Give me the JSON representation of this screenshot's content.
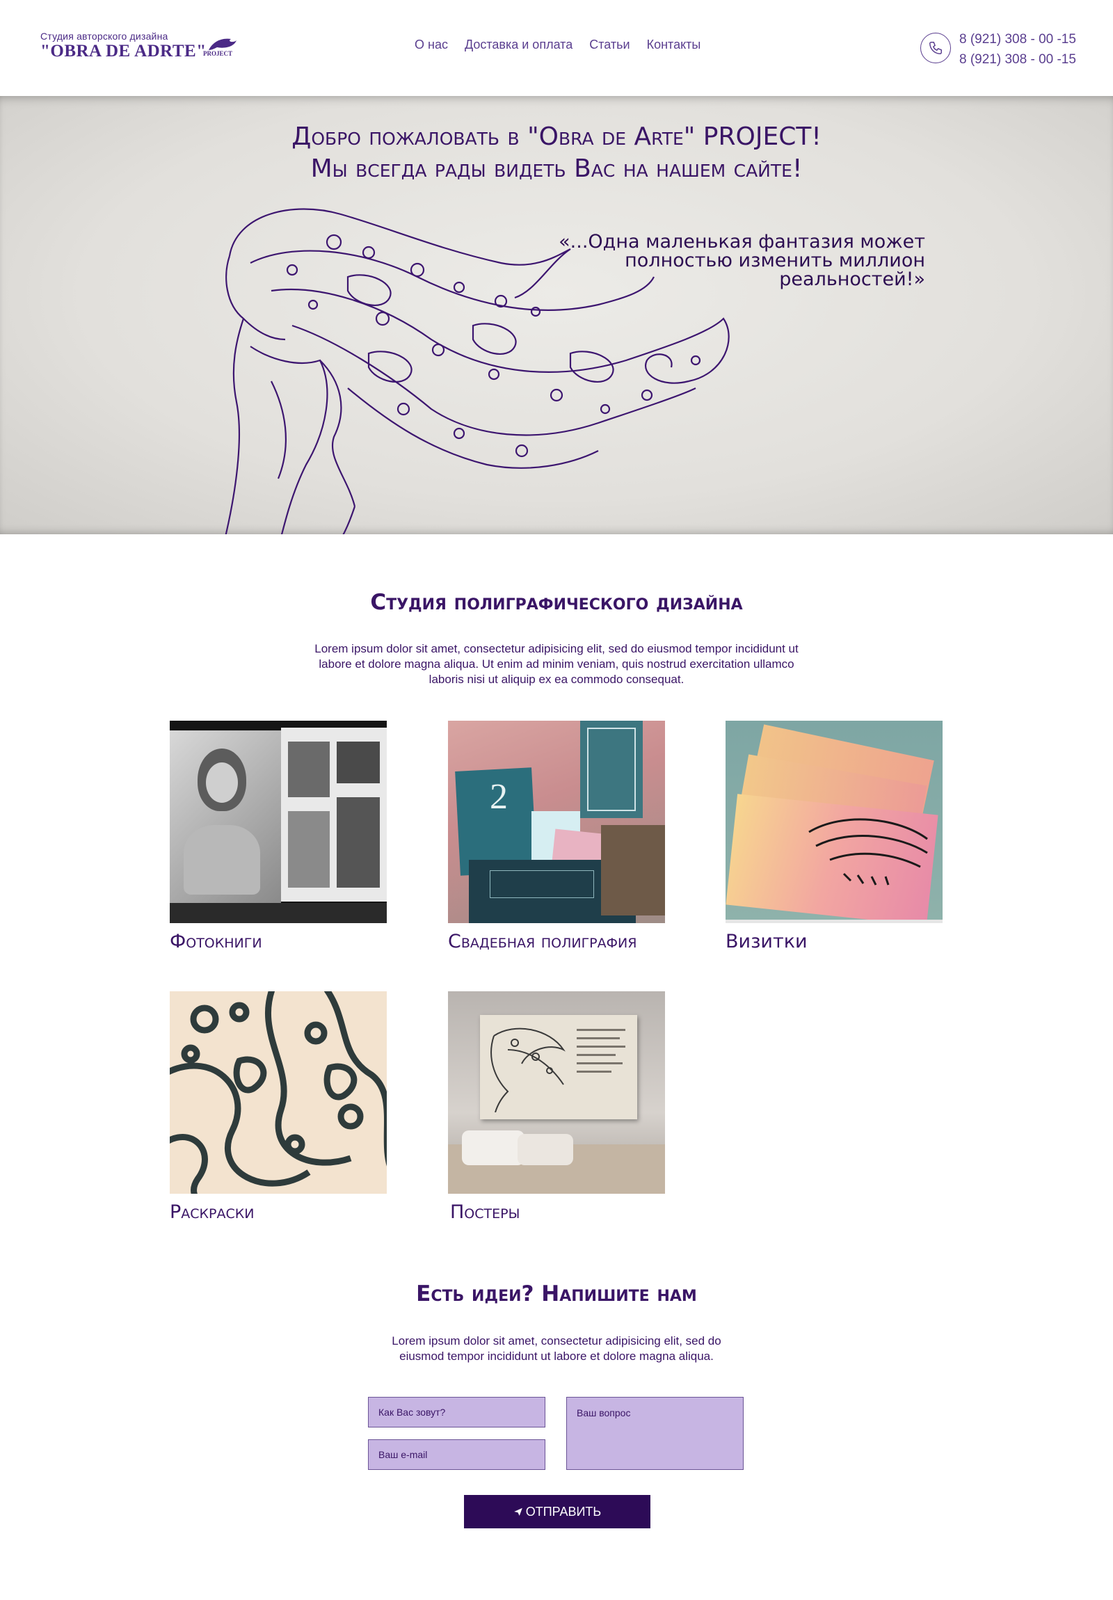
{
  "header": {
    "logo_tagline": "Студия авторского дизайна",
    "logo_name": "\"OBRA DE ADRTE\"",
    "logo_suffix": "PROJECT",
    "nav": [
      "О нас",
      "Доставка и оплата",
      "Статьи",
      "Контакты"
    ],
    "phones": [
      "8 (921) 308 - 00 -15",
      "8 (921) 308 - 00 -15"
    ],
    "phone_icon": "phone-icon"
  },
  "hero": {
    "title_line1": "Добро пожаловать в \"Obra de Arte\" PROJECT!",
    "title_line2": "Мы всегда рады видеть Вас на нашем сайте!",
    "quote_line1": "«...Одна маленькая фантазия может",
    "quote_line2": "полностью изменить миллион",
    "quote_line3": "реальностей!»"
  },
  "studio": {
    "title": "Студия полиграфического дизайна",
    "text": "Lorem ipsum dolor sit amet, consectetur adipisicing elit, sed do eiusmod tempor incididunt ut labore et dolore magna aliqua. Ut enim ad minim veniam, quis nostrud exercitation ullamco laboris nisi ut aliquip ex ea commodo consequat.",
    "cards": [
      {
        "label": "Фотокниги"
      },
      {
        "label": "Свадебная полиграфия"
      },
      {
        "label": "Визитки"
      },
      {
        "label": "Раскраски"
      },
      {
        "label": "Постеры"
      }
    ]
  },
  "contact": {
    "title": "Есть идеи? Напишите нам",
    "text": "Lorem ipsum dolor sit amet, consectetur adipisicing elit, sed do eiusmod tempor incididunt ut labore et dolore magna aliqua.",
    "name_placeholder": "Как Вас зовут?",
    "email_placeholder": "Ваш e-mail",
    "question_placeholder": "Ваш вопрос",
    "submit_label": "ОТПРАВИТЬ",
    "submit_icon": "paper-plane-icon"
  },
  "colors": {
    "brand_purple": "#3a1566",
    "field_fill": "#c7b5e3",
    "button_fill": "#2d0b57"
  }
}
